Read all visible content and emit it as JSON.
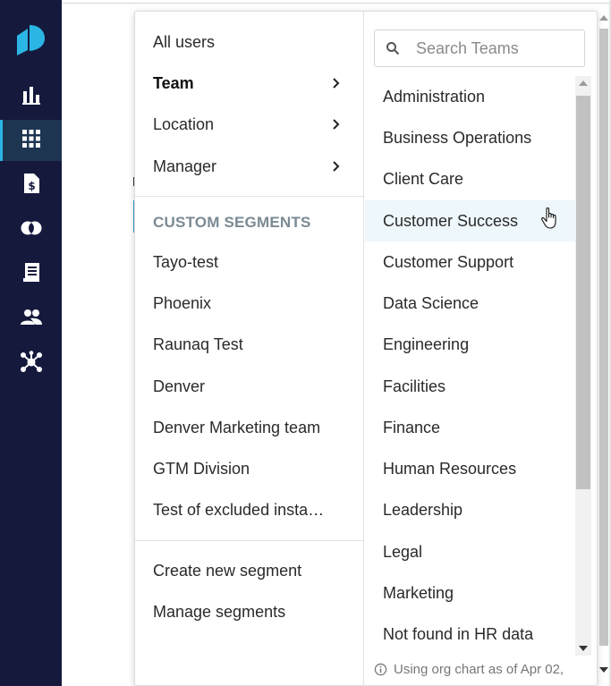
{
  "sidebar": {
    "logo": "brand-logo",
    "items": [
      {
        "icon": "bar-chart-icon",
        "active": false
      },
      {
        "icon": "grid-icon",
        "active": true
      },
      {
        "icon": "document-dollar-icon",
        "active": false
      },
      {
        "icon": "overlap-circles-icon",
        "active": false
      },
      {
        "icon": "receipt-icon",
        "active": false
      },
      {
        "icon": "people-icon",
        "active": false
      },
      {
        "icon": "network-icon",
        "active": false
      }
    ]
  },
  "filter_menu": {
    "main_items": [
      {
        "label": "All users",
        "has_submenu": false
      },
      {
        "label": "Team",
        "has_submenu": true
      },
      {
        "label": "Location",
        "has_submenu": true
      },
      {
        "label": "Manager",
        "has_submenu": true
      }
    ],
    "custom_segments_heading": "CUSTOM SEGMENTS",
    "custom_segments": [
      "Tayo-test",
      "Phoenix",
      "Raunaq Test",
      "Denver",
      "Denver Marketing team",
      "GTM Division",
      "Test of excluded insta…"
    ],
    "actions": [
      {
        "label": "Create new segment"
      },
      {
        "label": "Manage segments"
      }
    ]
  },
  "team_panel": {
    "search_placeholder": "Search Teams",
    "teams": [
      "Administration",
      "Business Operations",
      "Client Care",
      "Customer Success",
      "Customer Support",
      "Data Science",
      "Engineering",
      "Facilities",
      "Finance",
      "Human Resources",
      "Leadership",
      "Legal",
      "Marketing",
      "Not found in HR data"
    ],
    "hovered_team": "Customer Success",
    "footnote": "Using org chart as of Apr 02,"
  },
  "colors": {
    "sidebar_bg": "#151a3d",
    "sidebar_active_bg": "#1e3552",
    "accent": "#2bb5e5",
    "section_heading": "#7a8a94",
    "hover_row": "#eef7fb"
  }
}
